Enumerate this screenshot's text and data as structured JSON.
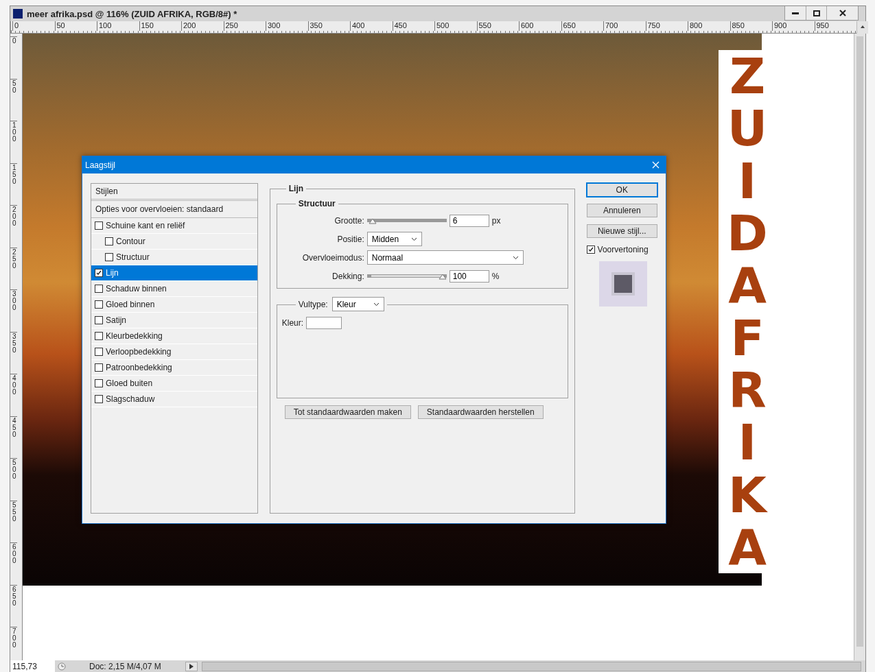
{
  "window": {
    "title": "meer afrika.psd @ 116% (ZUID AFRIKA, RGB/8#) *"
  },
  "rulers": {
    "horizontal": [
      "0",
      "50",
      "100",
      "150",
      "200",
      "250",
      "300",
      "350",
      "400",
      "450",
      "500",
      "550",
      "600",
      "650",
      "700",
      "750",
      "800",
      "850",
      "900",
      "950"
    ],
    "vertical": [
      "0",
      "50",
      "100",
      "150",
      "200",
      "250",
      "300",
      "350",
      "400",
      "450",
      "500",
      "550",
      "600",
      "650",
      "700"
    ]
  },
  "canvas": {
    "artwork_text": "ZUIDAFRIKA"
  },
  "status_bar": {
    "zoom": "115,73",
    "doc_info": "Doc: 2,15 M/4,07 M"
  },
  "dialog": {
    "title": "Laagstijl",
    "styles_header": "Stijlen",
    "blending_options": "Opties voor overvloeien: standaard",
    "effects": [
      {
        "label": "Schuine kant en reliëf",
        "checked": false,
        "selected": false,
        "children": [
          {
            "label": "Contour",
            "checked": false,
            "selected": false
          },
          {
            "label": "Structuur",
            "checked": false,
            "selected": false
          }
        ]
      },
      {
        "label": "Lijn",
        "checked": true,
        "selected": true
      },
      {
        "label": "Schaduw binnen",
        "checked": false,
        "selected": false
      },
      {
        "label": "Gloed binnen",
        "checked": false,
        "selected": false
      },
      {
        "label": "Satijn",
        "checked": false,
        "selected": false
      },
      {
        "label": "Kleurbedekking",
        "checked": false,
        "selected": false
      },
      {
        "label": "Verloopbedekking",
        "checked": false,
        "selected": false
      },
      {
        "label": "Patroonbedekking",
        "checked": false,
        "selected": false
      },
      {
        "label": "Gloed buiten",
        "checked": false,
        "selected": false
      },
      {
        "label": "Slagschaduw",
        "checked": false,
        "selected": false
      }
    ],
    "section_title": "Lijn",
    "structure": {
      "title": "Structuur",
      "size": {
        "label": "Grootte:",
        "level": 0.02,
        "value": "6",
        "unit": "px"
      },
      "position": {
        "label": "Positie:",
        "value": "Midden"
      },
      "blend_mode": {
        "label": "Overvloeimodus:",
        "value": "Normaal"
      },
      "opacity": {
        "label": "Dekking:",
        "level": 1,
        "value": "100",
        "unit": "%"
      }
    },
    "fill": {
      "type_label": "Vultype:",
      "type_value": "Kleur",
      "color_label": "Kleur:",
      "color": "#ffffff"
    },
    "bottom_buttons": [
      "Tot standaardwaarden maken",
      "Standaardwaarden herstellen"
    ],
    "side_buttons": [
      {
        "label": "OK",
        "default": true
      },
      {
        "label": "Annuleren",
        "default": false
      },
      {
        "label": "Nieuwe stijl...",
        "default": false
      }
    ],
    "preview": {
      "label": "Voorvertoning",
      "checked": true
    }
  }
}
